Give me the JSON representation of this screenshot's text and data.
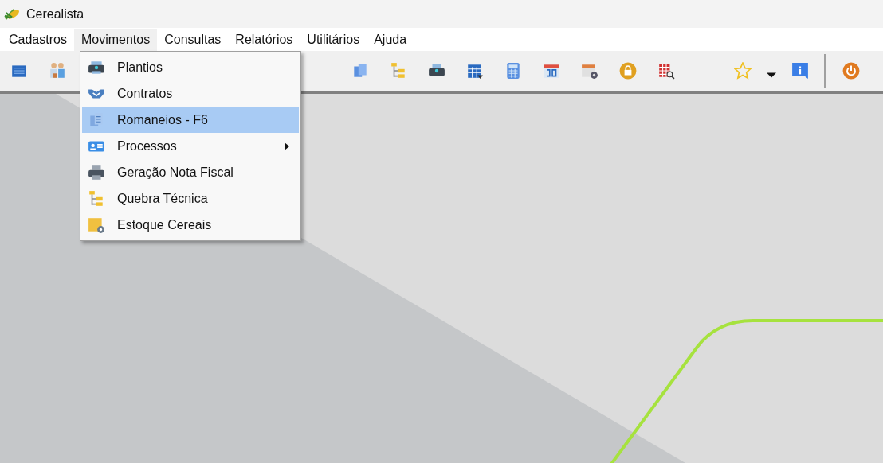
{
  "window": {
    "title": "Cerealista"
  },
  "menu_bar": [
    {
      "label": "Cadastros",
      "selected": false
    },
    {
      "label": "Movimentos",
      "selected": true
    },
    {
      "label": "Consultas",
      "selected": false
    },
    {
      "label": "Relatórios",
      "selected": false
    },
    {
      "label": "Utilitários",
      "selected": false
    },
    {
      "label": "Ajuda",
      "selected": false
    }
  ],
  "dropdown": [
    {
      "label": "Plantios",
      "selected": false,
      "submenu": false
    },
    {
      "label": "Contratos",
      "selected": false,
      "submenu": false
    },
    {
      "label": "Romaneios - F6",
      "selected": true,
      "submenu": false
    },
    {
      "label": "Processos",
      "selected": false,
      "submenu": true
    },
    {
      "label": "Geração Nota Fiscal",
      "selected": false,
      "submenu": false
    },
    {
      "label": "Quebra Técnica",
      "selected": false,
      "submenu": false
    },
    {
      "label": "Estoque Cereais",
      "selected": false,
      "submenu": false
    }
  ]
}
